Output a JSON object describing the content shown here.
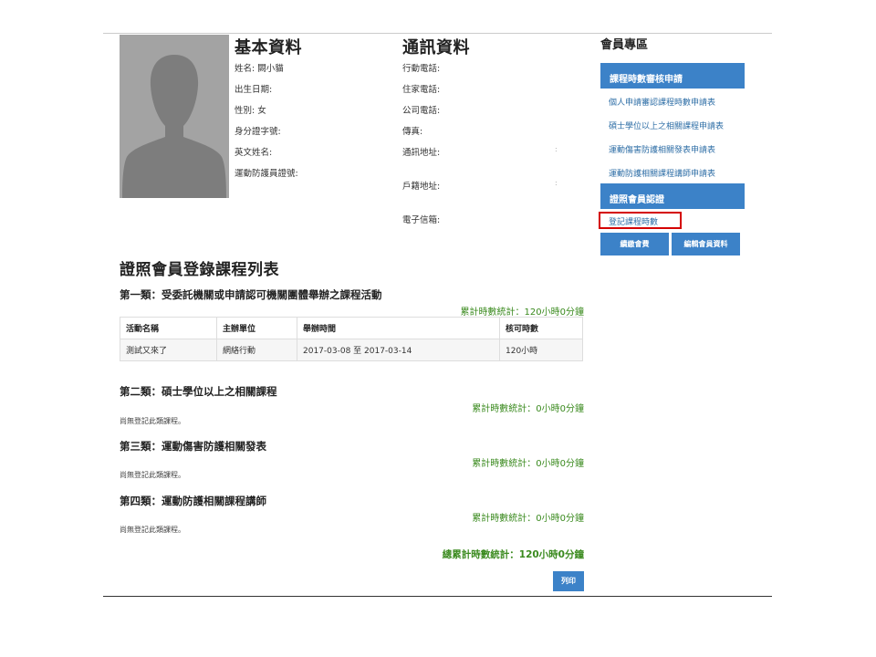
{
  "profile": {
    "basic_title": "基本資料",
    "contact_title": "通訊資料",
    "basic_fields": [
      "姓名: 闕小貓",
      "出生日期:",
      "性別: 女",
      "身分證字號:",
      "英文姓名:",
      "運動防護員證號:"
    ],
    "contact_fields": [
      "行動電話:",
      "住家電話:",
      "公司電話:",
      "傳真:",
      "通訊地址:",
      "戶籍地址:",
      "電子信箱:"
    ],
    "address_separator": ":"
  },
  "sidebar": {
    "title": "會員專區",
    "section1": {
      "header": "課程時數審核申請",
      "links": [
        "個人申請審認課程時數申請表",
        "碩士學位以上之相關課程申請表",
        "運動傷害防護相關發表申請表",
        "運動防護相關課程講師申請表"
      ]
    },
    "section2": {
      "header": "證照會員認證",
      "links": [
        "登記課程時數"
      ]
    },
    "buttons": [
      "續繳會費",
      "編輯會員資料"
    ]
  },
  "main": {
    "title": "證照會員登錄課程列表",
    "categories": [
      {
        "title": "第一類：受委託機關或申請認可機關團體舉辦之課程活動",
        "total": "累計時數統計：120小時0分鐘",
        "columns": [
          "活動名稱",
          "主辦單位",
          "舉辦時間",
          "核可時數"
        ],
        "rows": [
          [
            "測試又來了",
            "網絡行動",
            "2017-03-08 至 2017-03-14",
            "120小時"
          ]
        ]
      },
      {
        "title": "第二類：碩士學位以上之相關課程",
        "total": "累計時數統計：0小時0分鐘",
        "empty": "尚無登記此類課程。"
      },
      {
        "title": "第三類：運動傷害防護相關發表",
        "total": "累計時數統計：0小時0分鐘",
        "empty": "尚無登記此類課程。"
      },
      {
        "title": "第四類：運動防護相關課程講師",
        "total": "累計時數統計：0小時0分鐘",
        "empty": "尚無登記此類課程。"
      }
    ],
    "grand_total": "總累計時數統計：120小時0分鐘",
    "print_label": "列印"
  },
  "colors": {
    "accent_blue": "#3c82c8",
    "total_green": "#3a8a1e",
    "highlight_red": "#d40000",
    "avatar_gray": "#a3a3a3"
  },
  "icons": {
    "avatar": "person-silhouette-icon"
  }
}
